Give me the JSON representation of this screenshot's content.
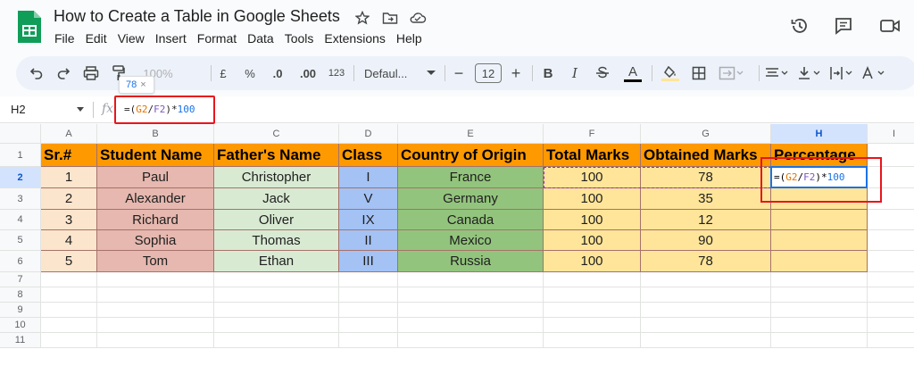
{
  "header": {
    "title": "How to Create a Table in Google Sheets",
    "menu": [
      "File",
      "Edit",
      "View",
      "Insert",
      "Format",
      "Data",
      "Tools",
      "Extensions",
      "Help"
    ]
  },
  "toolbar": {
    "zoom": "100%",
    "currency": "£",
    "percent": "%",
    "dec_decrease": ".0",
    "dec_increase": ".00",
    "number_format": "123",
    "font": "Defaul...",
    "font_size": "12",
    "minus": "−",
    "plus": "+",
    "bold": "B",
    "italic": "I",
    "text_color": "A"
  },
  "formula_bar": {
    "name_box": "H2",
    "fx": "fx",
    "formula_prefix": "=(",
    "ref1": "G2",
    "slash": "/",
    "ref2": "F2",
    "suffix_paren": ")*",
    "multiplier": "100",
    "tooltip_value": "78",
    "tooltip_close": "×"
  },
  "grid": {
    "columns": [
      "A",
      "B",
      "C",
      "D",
      "E",
      "F",
      "G",
      "H",
      "I"
    ],
    "rows": [
      "1",
      "2",
      "3",
      "4",
      "5",
      "6",
      "7",
      "8",
      "9",
      "10",
      "11"
    ],
    "selected_column": "H",
    "selected_row": "2",
    "headers": [
      "Sr.#",
      "Student Name",
      "Father's Name",
      "Class",
      "Country of Origin",
      "Total Marks",
      "Obtained Marks",
      "Percentage"
    ],
    "data": [
      [
        "1",
        "Paul",
        "Christopher",
        "I",
        "France",
        "100",
        "78"
      ],
      [
        "2",
        "Alexander",
        "Jack",
        "V",
        "Germany",
        "100",
        "35"
      ],
      [
        "3",
        "Richard",
        "Oliver",
        "IX",
        "Canada",
        "100",
        "12"
      ],
      [
        "4",
        "Sophia",
        "Thomas",
        "II",
        "Mexico",
        "100",
        "90"
      ],
      [
        "5",
        "Tom",
        "Ethan",
        "III",
        "Russia",
        "100",
        "78"
      ]
    ],
    "active_cell_formula": {
      "prefix": "=(",
      "ref1": "G2",
      "slash": "/",
      "ref2": "F2",
      "suffix": ")*",
      "multiplier": "100"
    }
  },
  "colors": {
    "header_fill": "#ff9900",
    "col_a": "#fce5cd",
    "col_b": "#e6b8af",
    "col_c": "#d9ead3",
    "col_d": "#a4c2f4",
    "col_e": "#93c47d",
    "col_fgh": "#ffe599",
    "highlight": "#e8151b",
    "accent": "#1a73e8"
  }
}
